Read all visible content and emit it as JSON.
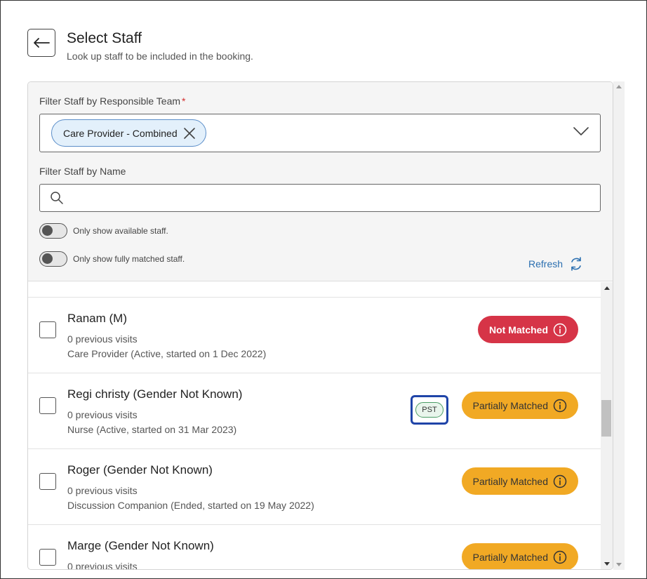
{
  "header": {
    "title": "Select Staff",
    "subtitle": "Look up staff to be included in the booking."
  },
  "filters": {
    "team_label": "Filter Staff by Responsible Team",
    "required_mark": "*",
    "selected_team": "Care Provider - Combined",
    "name_label": "Filter Staff by Name",
    "name_value": "",
    "toggle_available_label": "Only show available staff.",
    "toggle_matched_label": "Only show fully matched staff.",
    "toggle_available_on": false,
    "toggle_matched_on": false,
    "refresh_label": "Refresh"
  },
  "staff": [
    {
      "name": "Ranam (M)",
      "visits": "0 previous visits",
      "role": "Care Provider (Active, started on 1 Dec 2022)",
      "match": "Not Matched",
      "tag": ""
    },
    {
      "name": "Regi christy (Gender Not Known)",
      "visits": "0 previous visits",
      "role": "Nurse (Active, started on 31 Mar 2023)",
      "match": "Partially Matched",
      "tag": "PST"
    },
    {
      "name": "Roger (Gender Not Known)",
      "visits": "0 previous visits",
      "role": "Discussion Companion (Ended, started on 19 May 2022)",
      "match": "Partially Matched",
      "tag": ""
    },
    {
      "name": "Marge (Gender Not Known)",
      "visits": "0 previous visits",
      "role": "",
      "match": "Partially Matched",
      "tag": ""
    }
  ],
  "colors": {
    "not_matched": "#d63447",
    "partially_matched": "#f1a924",
    "link": "#2b6fb0",
    "highlight_box": "#1f44a8"
  },
  "icons": [
    "back-arrow-icon",
    "close-icon",
    "chevron-down-icon",
    "search-icon",
    "refresh-icon",
    "info-icon"
  ]
}
